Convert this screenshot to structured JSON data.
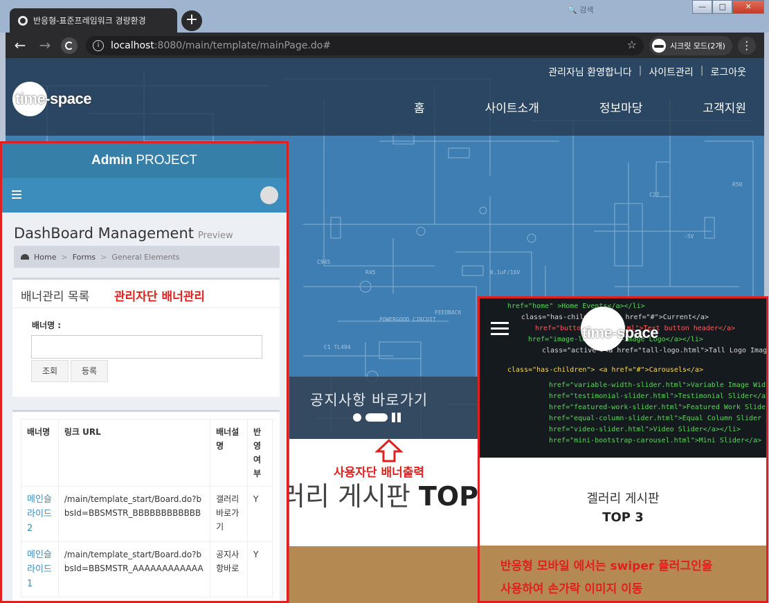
{
  "browser": {
    "tab_title": "반응형-표준프레임워크 경량환경",
    "new_tab": "+",
    "url_host": "localhost",
    "url_rest": ":8080/main/template/mainPage.do#",
    "incognito_label": "시크릿 모드(2개)",
    "window_buttons": [
      "—",
      "□",
      "✕"
    ],
    "faint_text": "🔍   검색"
  },
  "site": {
    "logo_text": "time-space",
    "util_links": [
      "관리자님 환영합니다",
      "사이트관리",
      "로그아웃"
    ],
    "nav": [
      "홈",
      "사이트소개",
      "정보마당",
      "고객지원"
    ],
    "slide_caption": "공지사항 바로가기",
    "gallery_heading_prefix": "러리 게시판 ",
    "gallery_heading_bold": "TOP",
    "user_banner_label": "사용자단 배너출력"
  },
  "admin": {
    "title_bold": "Admin",
    "title_rest": " PROJECT",
    "page_title": "DashBoard Management",
    "page_subtitle": "Preview",
    "breadcrumb": [
      "Home",
      "Forms",
      "General Elements"
    ],
    "list_title": "배너관리 목록",
    "admin_label": "관리자단 배너관리",
    "field_label": "배너명 :",
    "search_button": "조회",
    "register_button": "등록",
    "table_headers": [
      "배너명",
      "링크 URL",
      "배너설명",
      "반영여부"
    ],
    "rows": [
      {
        "name": "메인슬라이드2",
        "url": "/main/template_start/Board.do?bbsId=BBSMSTR_BBBBBBBBBBBB",
        "desc": "갤러리 바로가기",
        "applied": "Y"
      },
      {
        "name": "메인슬라이드1",
        "url": "/main/template_start/Board.do?bbsId=BBSMSTR_AAAAAAAAAAAA",
        "desc": "공지사항바로",
        "applied": "Y"
      }
    ]
  },
  "mobile": {
    "logo_text": "time-space",
    "gallery_title": "겔러리 게시판",
    "top3": "TOP 3",
    "note_line1": "반응형 모바일 에서는 swiper 플러그인을",
    "note_line2": "사용하여 손가락 이미지 이동"
  }
}
